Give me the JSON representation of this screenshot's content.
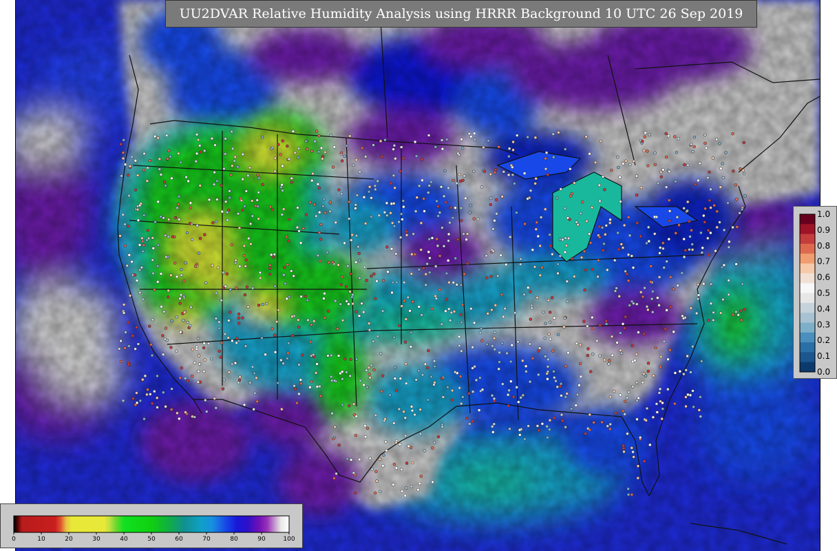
{
  "title": "UU2DVAR Relative Humidity Analysis using HRRR Background 10 UTC 26 Sep 2019",
  "colors": {
    "land_dry": "#c9c9c9",
    "ocean_blue": "#1e2bd6",
    "deep_blue": "#1020c0",
    "purple": "#6a1aa8",
    "green": "#19c81e",
    "yellow": "#e8e838",
    "cyan": "#12a0c8",
    "teal": "#19b89c",
    "border_line": "#111111",
    "panel_gray": "#c8c8c8"
  },
  "rh_colorbar": {
    "ticks": [
      "0",
      "10",
      "20",
      "30",
      "40",
      "50",
      "60",
      "70",
      "80",
      "90",
      "100"
    ],
    "min": 0,
    "max": 100,
    "stops": [
      {
        "v": 0,
        "c": "#000000"
      },
      {
        "v": 1,
        "c": "#3a0000"
      },
      {
        "v": 3,
        "c": "#b81c1c"
      },
      {
        "v": 15,
        "c": "#c81e1e"
      },
      {
        "v": 17,
        "c": "#e05030"
      },
      {
        "v": 19,
        "c": "#e8c040"
      },
      {
        "v": 21,
        "c": "#e8e838"
      },
      {
        "v": 33,
        "c": "#e8e838"
      },
      {
        "v": 35,
        "c": "#b8e040"
      },
      {
        "v": 37,
        "c": "#70d830"
      },
      {
        "v": 40,
        "c": "#10e020"
      },
      {
        "v": 50,
        "c": "#10d010"
      },
      {
        "v": 56,
        "c": "#10b040"
      },
      {
        "v": 62,
        "c": "#109090"
      },
      {
        "v": 68,
        "c": "#10a0c8"
      },
      {
        "v": 72,
        "c": "#1890e0"
      },
      {
        "v": 77,
        "c": "#1848e8"
      },
      {
        "v": 81,
        "c": "#1818d8"
      },
      {
        "v": 85,
        "c": "#3010c8"
      },
      {
        "v": 89,
        "c": "#7010b8"
      },
      {
        "v": 92,
        "c": "#9830b8"
      },
      {
        "v": 95,
        "c": "#c8a0d0"
      },
      {
        "v": 97,
        "c": "#e8e8e8"
      },
      {
        "v": 100,
        "c": "#ffffff"
      }
    ]
  },
  "error_legend": {
    "ticks": [
      "1.0",
      "0.9",
      "0.8",
      "0.7",
      "0.6",
      "0.5",
      "0.4",
      "0.3",
      "0.2",
      "0.1",
      "0.0"
    ],
    "bins": [
      "#67001f",
      "#9e1326",
      "#c43c3c",
      "#dd6a4f",
      "#f09e6f",
      "#f6c9a8",
      "#f2e0d4",
      "#f7f7f7",
      "#e7e7e7",
      "#c6d3dc",
      "#a7c3d3",
      "#7eafc9",
      "#4a8fbd",
      "#2a6fa6",
      "#1b568f",
      "#0c3a6e"
    ]
  }
}
